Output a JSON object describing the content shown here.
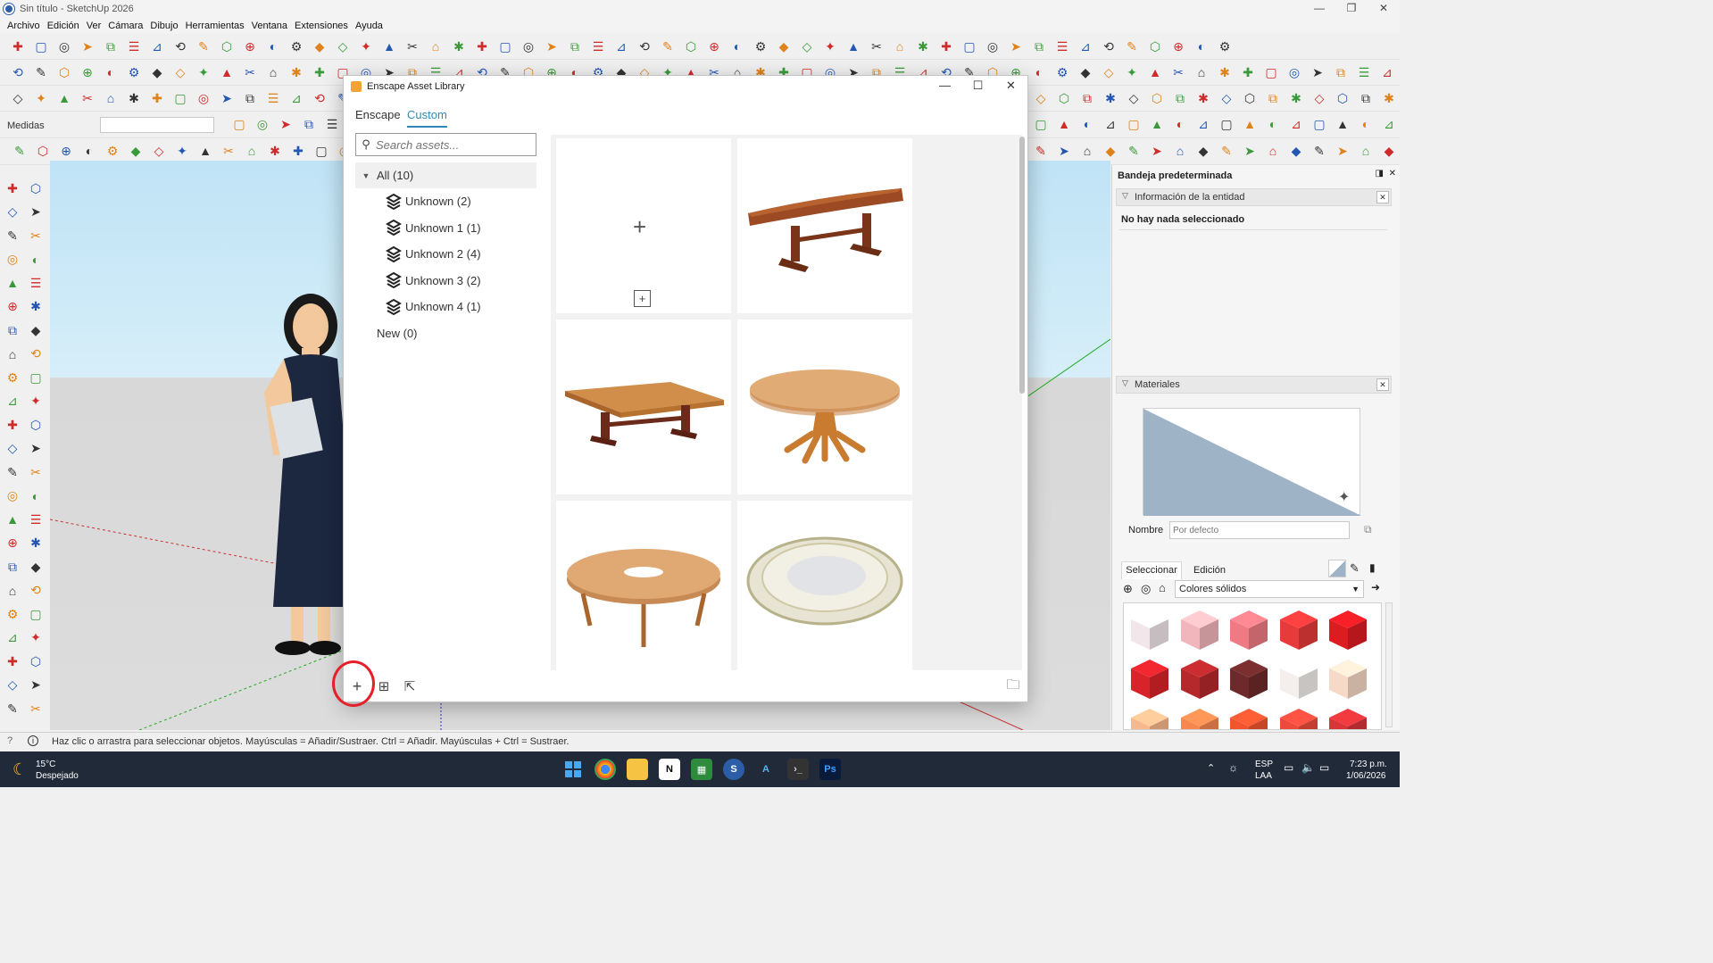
{
  "window": {
    "title": "Sin título - SketchUp 2026"
  },
  "menu": [
    "Archivo",
    "Edición",
    "Ver",
    "Cámara",
    "Dibujo",
    "Herramientas",
    "Ventana",
    "Extensiones",
    "Ayuda"
  ],
  "measurements": {
    "label": "Medidas",
    "value": ""
  },
  "dialog": {
    "title": "Enscape Asset Library",
    "tabs": [
      {
        "label": "Enscape",
        "active": false
      },
      {
        "label": "Custom",
        "active": true
      }
    ],
    "search_placeholder": "Search assets...",
    "tree": {
      "all": "All (10)",
      "children": [
        "Unknown (2)",
        "Unknown 1 (1)",
        "Unknown 2 (4)",
        "Unknown 3 (2)",
        "Unknown 4 (1)"
      ],
      "new": "New (0)"
    },
    "assets": [
      {
        "type": "add-placeholder"
      },
      {
        "type": "rectangular-wood-table"
      },
      {
        "type": "rectangular-light-wood-table"
      },
      {
        "type": "round-pedestal-table"
      },
      {
        "type": "round-table-with-hole"
      },
      {
        "type": "decorative-plate"
      }
    ],
    "bottom_icons": [
      "plus-icon",
      "add-folder-icon",
      "export-icon",
      "open-folder-icon"
    ]
  },
  "tray": {
    "title": "Bandeja predeterminada",
    "entity_section": "Información de la entidad",
    "entity_empty": "No hay nada seleccionado",
    "materials_section": "Materiales",
    "name_label": "Nombre",
    "name_placeholder": "Por defecto",
    "tabs": [
      "Seleccionar",
      "Edición"
    ],
    "library": "Colores sólidos",
    "swatches": [
      "#f2e6ea",
      "#f0b6bb",
      "#ee7b83",
      "#e73a3a",
      "#dd1c22",
      "#d9232a",
      "#b5282c",
      "#6e2a2a",
      "#f4efec",
      "#f6d9c6",
      "#f7b88c",
      "#f6874f",
      "#f2552e",
      "#ee4a3c",
      "#d93438"
    ]
  },
  "status": {
    "text": "Haz clic o arrastra para seleccionar objetos. Mayúsculas = Añadir/Sustraer. Ctrl = Añadir. Mayúsculas + Ctrl = Sustraer."
  },
  "taskbar": {
    "weather_temp": "15°C",
    "weather_text": "Despejado",
    "lang": "ESP",
    "lang2": "LAA",
    "time": "7:23 p.m.",
    "date": "1/06/2026"
  },
  "colors": {
    "accent": "#2e8bb7",
    "highlight": "#e5202a"
  }
}
